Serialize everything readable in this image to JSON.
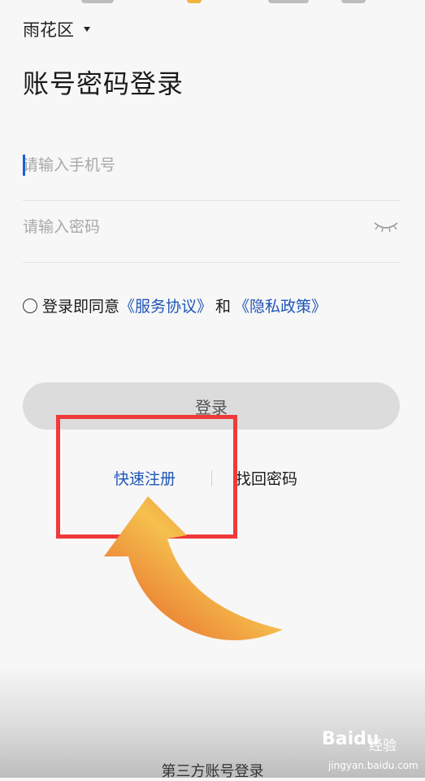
{
  "region": {
    "label": "雨花区"
  },
  "page": {
    "title": "账号密码登录"
  },
  "form": {
    "phone_placeholder": "请输入手机号",
    "password_placeholder": "请输入密码"
  },
  "agreement": {
    "prefix": "登录即同意",
    "service_link": "《服务协议》",
    "and": "和",
    "privacy_link": "《隐私政策》"
  },
  "buttons": {
    "login": "登录"
  },
  "links": {
    "quick_register": "快速注册",
    "find_password": "找回密码"
  },
  "footer": {
    "third_party": "第三方账号登录"
  },
  "watermark": {
    "brand": "Baidu",
    "suffix": "经验",
    "url": "jingyan.baidu.com"
  },
  "colors": {
    "accent": "#1f56b8",
    "highlight": "#f0393a",
    "arrow_start": "#f5c04e",
    "arrow_end": "#e55a24",
    "button_bg": "#dcdcdc"
  },
  "icons": {
    "region_caret": "chevron-down-icon",
    "password_toggle": "eye-closed-icon",
    "annotation_arrow": "curved-arrow-icon"
  }
}
